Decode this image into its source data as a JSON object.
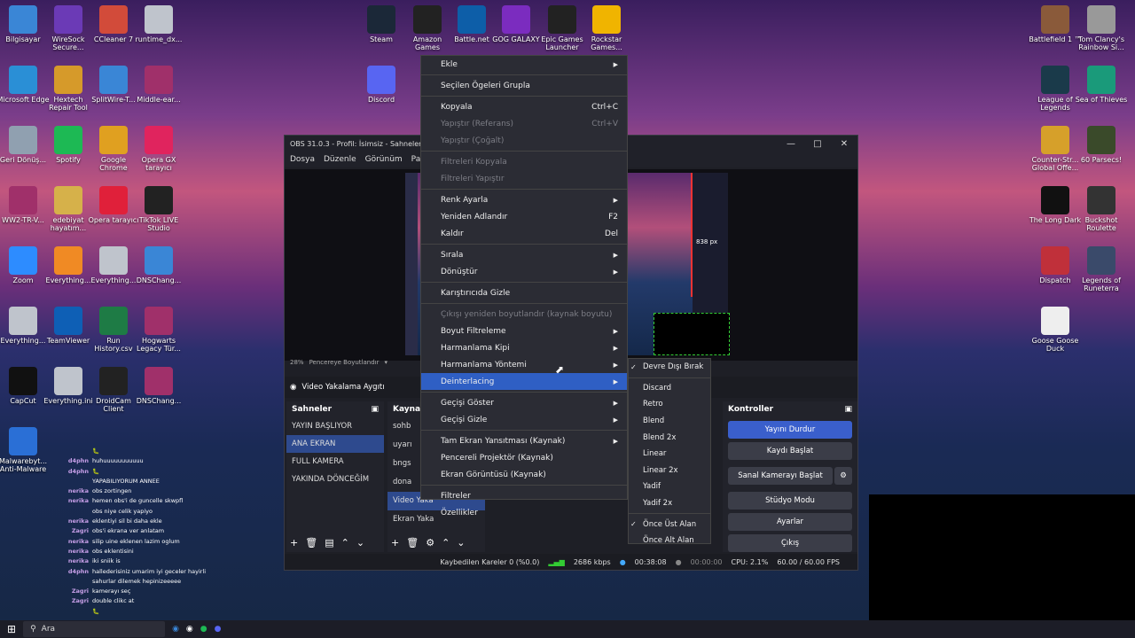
{
  "desktop": {
    "left_icons": [
      {
        "label": "Bilgisayar",
        "color": "#3a86d6"
      },
      {
        "label": "WireSock Secure...",
        "color": "#6b3ab6"
      },
      {
        "label": "CCleaner 7",
        "color": "#d24b3a"
      },
      {
        "label": "runtime_dx...",
        "color": "#bfc4cc"
      },
      {
        "label": "Microsoft Edge",
        "color": "#2a8fd6"
      },
      {
        "label": "Hextech Repair Tool",
        "color": "#d69a2a"
      },
      {
        "label": "SplitWire-T...",
        "color": "#3a86d6"
      },
      {
        "label": "Middle-ear...",
        "color": "#a0306a"
      },
      {
        "label": "Geri Dönüş...",
        "color": "#90a0b0"
      },
      {
        "label": "Spotify",
        "color": "#1db954"
      },
      {
        "label": "Google Chrome",
        "color": "#e0a020"
      },
      {
        "label": "Opera GX tarayıcı",
        "color": "#e0245e"
      },
      {
        "label": "WW2-TR-V...",
        "color": "#a0306a"
      },
      {
        "label": "edebiyat hayatım...",
        "color": "#d6b14a"
      },
      {
        "label": "Opera tarayıcı",
        "color": "#e0203a"
      },
      {
        "label": "TikTok LIVE Studio",
        "color": "#222"
      },
      {
        "label": "Zoom",
        "color": "#2d8cff"
      },
      {
        "label": "Everything...",
        "color": "#f08a24"
      },
      {
        "label": "Everything...",
        "color": "#bfc4cc"
      },
      {
        "label": "DNSChang...",
        "color": "#3a86d6"
      },
      {
        "label": "Everything...",
        "color": "#bfc4cc"
      },
      {
        "label": "TeamViewer",
        "color": "#0e5fb5"
      },
      {
        "label": "Run History.csv",
        "color": "#1e7b45"
      },
      {
        "label": "Hogwarts Legacy Tür...",
        "color": "#a0306a"
      },
      {
        "label": "CapCut",
        "color": "#111"
      },
      {
        "label": "Everything.ini",
        "color": "#bfc4cc"
      },
      {
        "label": "DroidCam Client",
        "color": "#222"
      },
      {
        "label": "DNSChang...",
        "color": "#a0306a"
      },
      {
        "label": "Malwarebyt... Anti-Malware",
        "color": "#2a6fd6"
      }
    ],
    "top_icons": [
      {
        "label": "Steam",
        "color": "#1b2838"
      },
      {
        "label": "Amazon Games",
        "color": "#222"
      },
      {
        "label": "Battle.net",
        "color": "#0d5ea8"
      },
      {
        "label": "GOG GALAXY",
        "color": "#7b2cbf"
      },
      {
        "label": "Epic Games Launcher",
        "color": "#222"
      },
      {
        "label": "Rockstar Games...",
        "color": "#f0b400"
      },
      {
        "label": "Discord",
        "color": "#5865f2"
      }
    ],
    "right_icons": [
      {
        "label": "Battlefield 1 ™",
        "color": "#8a5a3a"
      },
      {
        "label": "Tom Clancy's Rainbow Si...",
        "color": "#999"
      },
      {
        "label": "League of Legends",
        "color": "#1a3a4a"
      },
      {
        "label": "Sea of Thieves",
        "color": "#1a9a7a"
      },
      {
        "label": "Counter-Str... Global Offe...",
        "color": "#d6a02a"
      },
      {
        "label": "60 Parsecs!",
        "color": "#3a4a2a"
      },
      {
        "label": "The Long Dark",
        "color": "#111"
      },
      {
        "label": "Buckshot Roulette",
        "color": "#333"
      },
      {
        "label": "Dispatch",
        "color": "#c0303a"
      },
      {
        "label": "Legends of Runeterra",
        "color": "#3a4a6a"
      },
      {
        "label": "Goose Goose Duck",
        "color": "#eee"
      }
    ]
  },
  "obs": {
    "title": "OBS 31.0.3 - Profil: İsimsiz - Sahneler: İ",
    "menu": [
      "Dosya",
      "Düzenle",
      "Görünüm",
      "Pane"
    ],
    "zoom": "28%",
    "zoom_label": "Pencereye Boyutlandır",
    "source_bar": "Video Yakalama Aygıtı",
    "preview_size_label": "838 px",
    "scenes_title": "Sahneler",
    "scenes": [
      "YAYIN BAŞLIYOR",
      "ANA EKRAN",
      "FULL KAMERA",
      "YAKINDA DÖNCEĞİM"
    ],
    "active_scene_index": 1,
    "sources_title": "Kaynak",
    "sources": [
      "sohb",
      "uyarı",
      "bngs",
      "dona",
      "Video Yaka",
      "Ekran Yaka"
    ],
    "controls_title": "Kontroller",
    "controls": {
      "stop_stream": "Yayını Durdur",
      "record": "Kaydı Başlat",
      "virtual_cam": "Sanal Kamerayı Başlat",
      "studio": "Stüdyo Modu",
      "settings": "Ayarlar",
      "exit": "Çıkış"
    },
    "status": {
      "dropped": "Kaybedilen Kareler 0 (%0.0)",
      "bitrate": "2686 kbps",
      "stream_time": "00:38:08",
      "rec_time": "00:00:00",
      "cpu": "CPU: 2.1%",
      "fps": "60.00 / 60.00 FPS"
    }
  },
  "context_menu": {
    "items": [
      {
        "label": "Ekle",
        "shortcut": "",
        "arrow": true,
        "disabled": false
      },
      {
        "sep": true
      },
      {
        "label": "Seçilen Ögeleri Grupla",
        "shortcut": "",
        "arrow": false,
        "disabled": false
      },
      {
        "sep": true
      },
      {
        "label": "Kopyala",
        "shortcut": "Ctrl+C",
        "arrow": false,
        "disabled": false
      },
      {
        "label": "Yapıştır (Referans)",
        "shortcut": "Ctrl+V",
        "arrow": false,
        "disabled": true
      },
      {
        "label": "Yapıştır (Çoğalt)",
        "shortcut": "",
        "arrow": false,
        "disabled": true
      },
      {
        "sep": true
      },
      {
        "label": "Filtreleri Kopyala",
        "shortcut": "",
        "arrow": false,
        "disabled": true
      },
      {
        "label": "Filtreleri Yapıştır",
        "shortcut": "",
        "arrow": false,
        "disabled": true
      },
      {
        "sep": true
      },
      {
        "label": "Renk Ayarla",
        "shortcut": "",
        "arrow": true,
        "disabled": false
      },
      {
        "label": "Yeniden Adlandır",
        "shortcut": "F2",
        "arrow": false,
        "disabled": false
      },
      {
        "label": "Kaldır",
        "shortcut": "Del",
        "arrow": false,
        "disabled": false
      },
      {
        "sep": true
      },
      {
        "label": "Sırala",
        "shortcut": "",
        "arrow": true,
        "disabled": false
      },
      {
        "label": "Dönüştür",
        "shortcut": "",
        "arrow": true,
        "disabled": false
      },
      {
        "sep": true
      },
      {
        "label": "Karıştırıcıda Gizle",
        "shortcut": "",
        "arrow": false,
        "disabled": false
      },
      {
        "sep": true
      },
      {
        "label": "Çıkışı yeniden boyutlandır (kaynak boyutu)",
        "shortcut": "",
        "arrow": false,
        "disabled": true
      },
      {
        "label": "Boyut Filtreleme",
        "shortcut": "",
        "arrow": true,
        "disabled": false
      },
      {
        "label": "Harmanlama Kipi",
        "shortcut": "",
        "arrow": true,
        "disabled": false
      },
      {
        "label": "Harmanlama Yöntemi",
        "shortcut": "",
        "arrow": true,
        "disabled": false
      },
      {
        "label": "Deinterlacing",
        "shortcut": "",
        "arrow": true,
        "disabled": false,
        "active": true
      },
      {
        "sep": true
      },
      {
        "label": "Geçişi Göster",
        "shortcut": "",
        "arrow": true,
        "disabled": false
      },
      {
        "label": "Geçişi Gizle",
        "shortcut": "",
        "arrow": true,
        "disabled": false
      },
      {
        "sep": true
      },
      {
        "label": "Tam Ekran Yansıtması (Kaynak)",
        "shortcut": "",
        "arrow": true,
        "disabled": false
      },
      {
        "label": "Pencereli Projektör (Kaynak)",
        "shortcut": "",
        "arrow": false,
        "disabled": false
      },
      {
        "label": "Ekran Görüntüsü (Kaynak)",
        "shortcut": "",
        "arrow": false,
        "disabled": false
      },
      {
        "sep": true
      },
      {
        "label": "Filtreler",
        "shortcut": "",
        "arrow": false,
        "disabled": false
      },
      {
        "label": "Özellikler",
        "shortcut": "",
        "arrow": false,
        "disabled": false
      }
    ]
  },
  "submenu": {
    "items": [
      {
        "label": "Devre Dışı Bırak",
        "checked": true
      },
      {
        "sep": true
      },
      {
        "label": "Discard",
        "checked": false
      },
      {
        "label": "Retro",
        "checked": false
      },
      {
        "label": "Blend",
        "checked": false
      },
      {
        "label": "Blend 2x",
        "checked": false
      },
      {
        "label": "Linear",
        "checked": false
      },
      {
        "label": "Linear 2x",
        "checked": false
      },
      {
        "label": "Yadif",
        "checked": false
      },
      {
        "label": "Yadif 2x",
        "checked": false
      },
      {
        "sep": true
      },
      {
        "label": "Önce Üst Alan",
        "checked": true
      },
      {
        "label": "Önce Alt Alan",
        "checked": false
      }
    ]
  },
  "chat": [
    {
      "name": "",
      "msg": "🐛"
    },
    {
      "name": "d4phn",
      "msg": "huhuuuuuuuuuuu"
    },
    {
      "name": "d4phn",
      "msg": "🐛"
    },
    {
      "name": "",
      "msg": "YAPABILIYORUM ANNEE"
    },
    {
      "name": "nerika",
      "msg": "obs zortingen"
    },
    {
      "name": "nerika",
      "msg": "hemen obs'i de guncelle skwpfl"
    },
    {
      "name": "",
      "msg": "obs niye celik yapiyo"
    },
    {
      "name": "nerika",
      "msg": "eklentiyi sil bi daha ekle"
    },
    {
      "name": "Zagri",
      "msg": "obs'i ekrana ver anlatam"
    },
    {
      "name": "nerika",
      "msg": "silip uine eklenen lazim oglum"
    },
    {
      "name": "nerika",
      "msg": "obs eklentisini"
    },
    {
      "name": "nerika",
      "msg": "iki sniik is"
    },
    {
      "name": "d4phn",
      "msg": "hallederisiniz umarim iyi geceler hayirli"
    },
    {
      "name": "",
      "msg": "sahurlar dilemek hepinizeeeee"
    },
    {
      "name": "Zagri",
      "msg": "kamerayı seç"
    },
    {
      "name": "Zagri",
      "msg": "double clikc at"
    },
    {
      "name": "",
      "msg": "🐛"
    }
  ],
  "taskbar": {
    "search_placeholder": "Ara"
  }
}
